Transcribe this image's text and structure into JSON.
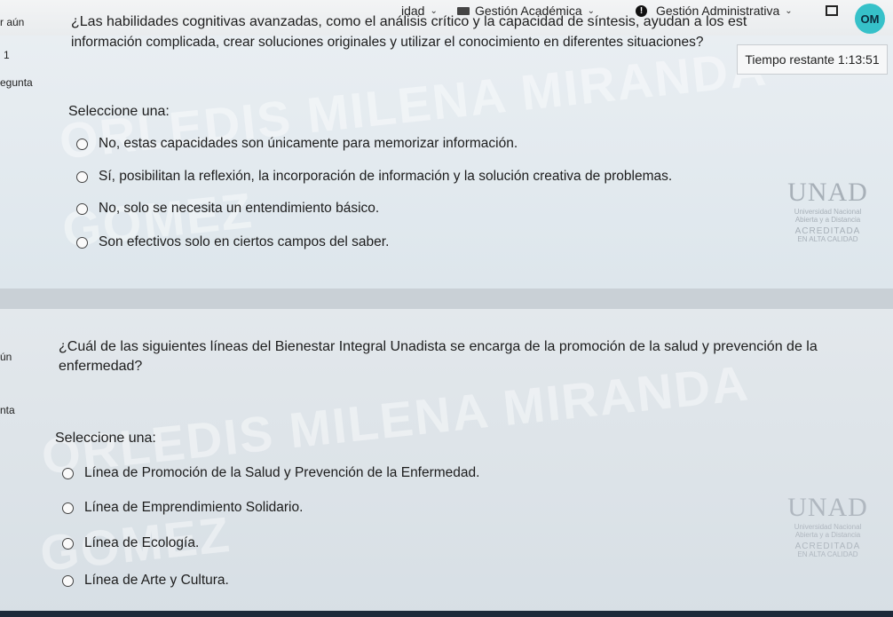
{
  "topbar": {
    "nav_partial": "idad",
    "nav_gestion_academica": "Gestión Académica",
    "nav_gestion_admin": "Gestión Administrativa",
    "alert_glyph": "!",
    "avatar_initials": "OM"
  },
  "sidebar": {
    "q1_status": "r aún",
    "q1_number": "1",
    "q1_label": "egunta",
    "q2_status": "ún",
    "q2_label": "nta"
  },
  "timer": {
    "label": "Tiempo restante 1:13:51"
  },
  "question1": {
    "text": "¿Las habilidades cognitivas avanzadas, como el análisis crítico y la capacidad de síntesis, ayudan a los est",
    "text_line2": "información complicada, crear soluciones originales y utilizar el conocimiento en diferentes situaciones?",
    "select_label": "Seleccione una:",
    "options": [
      "No, estas capacidades son únicamente para memorizar información.",
      "Sí, posibilitan la reflexión, la incorporación de información y la solución creativa de problemas.",
      "No, solo se necesita un entendimiento básico.",
      "Son efectivos solo en ciertos campos del saber."
    ]
  },
  "question2": {
    "text": "¿Cuál de las siguientes líneas del Bienestar Integral Unadista se encarga de la promoción de la salud y prevención de la",
    "text_line2": "enfermedad?",
    "select_label": "Seleccione una:",
    "options": [
      "Línea de Promoción de la Salud y Prevención de la Enfermedad.",
      "Línea de Emprendimiento Solidario.",
      "Línea de Ecología.",
      "Línea de Arte y Cultura."
    ]
  },
  "watermark": {
    "line1": "ORLEDIS MILENA MIRANDA",
    "line2": "GOMEZ"
  },
  "logo": {
    "name": "UNAD",
    "subtitle1": "Universidad Nacional",
    "subtitle2": "Abierta y a Distancia",
    "accredited": "ACREDITADA",
    "quality": "EN ALTA CALIDAD"
  },
  "colors": {
    "avatar_bg": "#36c1c9",
    "page_bg": "#e6e9ec"
  }
}
